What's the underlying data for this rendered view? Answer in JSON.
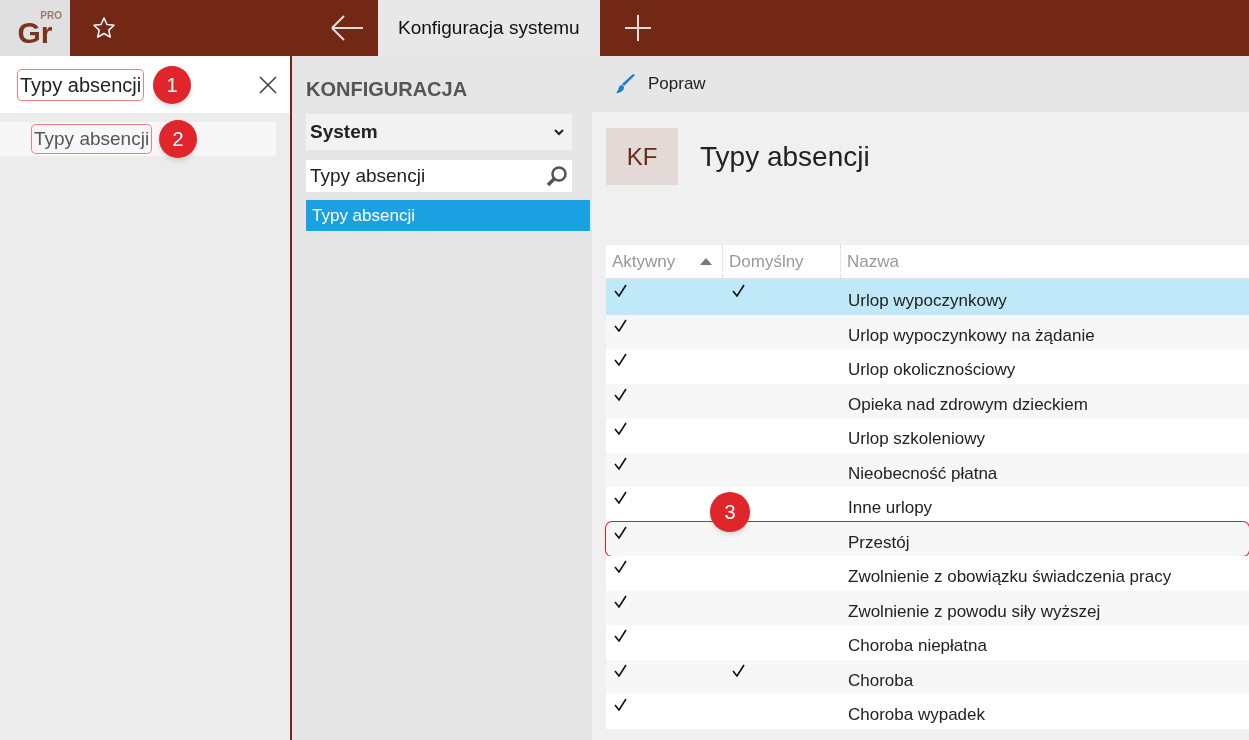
{
  "app": {
    "logo": "Gr",
    "logo_badge": "PRO"
  },
  "tabs": [
    {
      "label": "Konfiguracja systemu",
      "selected": true
    }
  ],
  "search": {
    "value": "Typy absencji",
    "callout": "1"
  },
  "results": [
    {
      "label": "Typy absencji",
      "callout": "2"
    }
  ],
  "config": {
    "heading": "KONFIGURACJA",
    "dropdown": "System",
    "filter": "Typy absencji",
    "items": [
      {
        "label": "Typy absencji",
        "selected": true
      }
    ]
  },
  "toolbar": {
    "buttons": [
      "Popraw"
    ]
  },
  "page": {
    "tile": "KF",
    "title": "Typy absencji"
  },
  "table": {
    "columns": [
      {
        "label": "Aktywny",
        "sorted": true
      },
      {
        "label": "Domyślny",
        "sorted": false
      },
      {
        "label": "Nazwa",
        "sorted": false
      }
    ],
    "callout": "3",
    "rows": [
      {
        "active": true,
        "default": true,
        "name": "Urlop wypoczynkowy",
        "selected": true,
        "outlined": false
      },
      {
        "active": true,
        "default": false,
        "name": "Urlop wypoczynkowy na żądanie",
        "selected": false,
        "outlined": false
      },
      {
        "active": true,
        "default": false,
        "name": "Urlop okolicznościowy",
        "selected": false,
        "outlined": false
      },
      {
        "active": true,
        "default": false,
        "name": "Opieka nad zdrowym dzieckiem",
        "selected": false,
        "outlined": false
      },
      {
        "active": true,
        "default": false,
        "name": "Urlop szkoleniowy",
        "selected": false,
        "outlined": false
      },
      {
        "active": true,
        "default": false,
        "name": "Nieobecność płatna",
        "selected": false,
        "outlined": false
      },
      {
        "active": true,
        "default": false,
        "name": "Inne urlopy",
        "selected": false,
        "outlined": false
      },
      {
        "active": true,
        "default": false,
        "name": "Przestój",
        "selected": false,
        "outlined": true
      },
      {
        "active": true,
        "default": false,
        "name": "Zwolnienie z obowiązku świadczenia pracy",
        "selected": false,
        "outlined": false
      },
      {
        "active": true,
        "default": false,
        "name": "Zwolnienie z powodu siły wyższej",
        "selected": false,
        "outlined": false
      },
      {
        "active": true,
        "default": false,
        "name": "Choroba niepłatna",
        "selected": false,
        "outlined": false
      },
      {
        "active": true,
        "default": true,
        "name": "Choroba",
        "selected": false,
        "outlined": false
      },
      {
        "active": true,
        "default": false,
        "name": "Choroba wypadek",
        "selected": false,
        "outlined": false
      }
    ]
  }
}
